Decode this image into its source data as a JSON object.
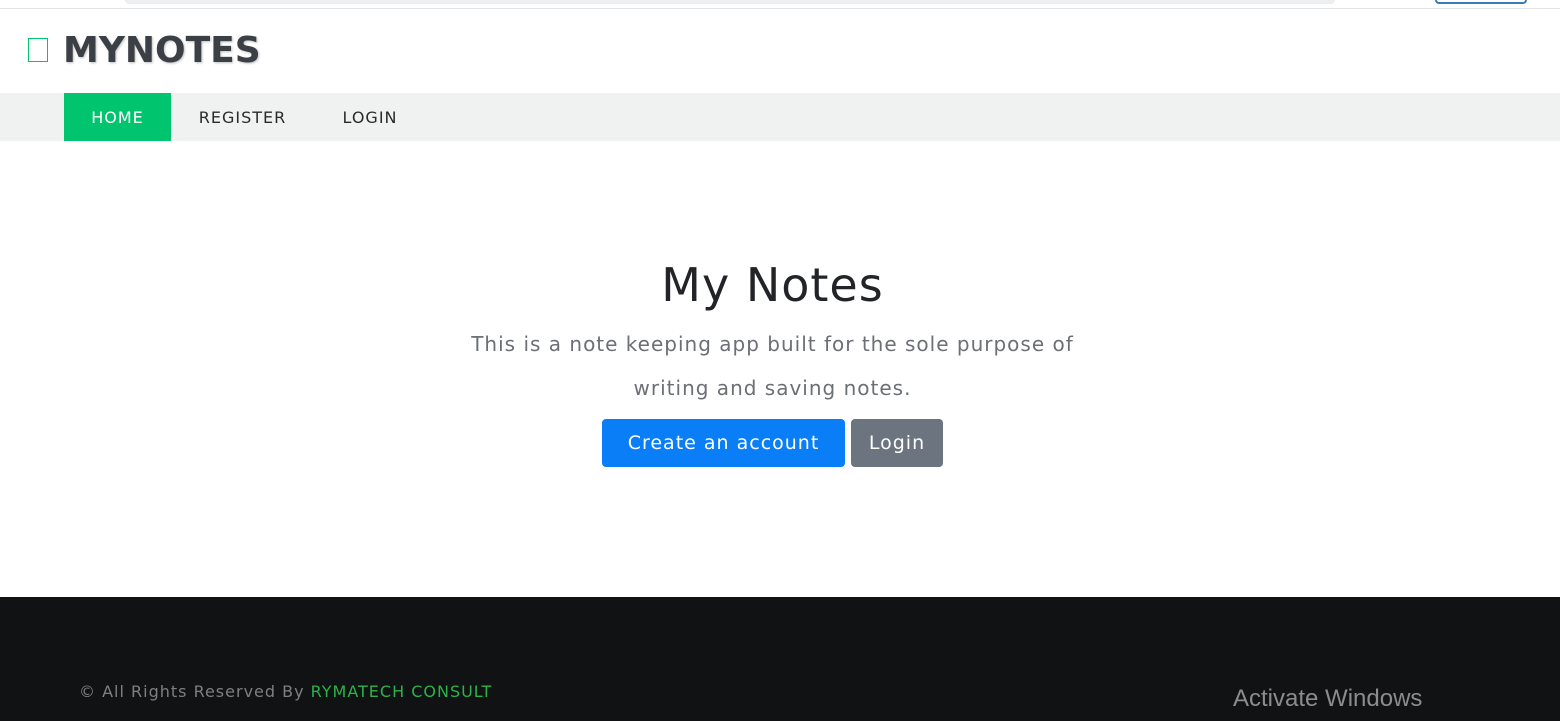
{
  "brand": {
    "title": "MYNOTES",
    "icon": "notebook-outline-icon",
    "accent_color": "#00c56e"
  },
  "nav": {
    "items": [
      {
        "label": "HOME",
        "active": true
      },
      {
        "label": "REGISTER",
        "active": false
      },
      {
        "label": "LOGIN",
        "active": false
      }
    ],
    "active_color": "#00c56e",
    "background": "#f0f2f1"
  },
  "hero": {
    "title": "My Notes",
    "description": "This is a note keeping app built for the sole purpose of writing and saving notes.",
    "primary_button": "Create an account",
    "secondary_button": "Login",
    "primary_color": "#0a7ef7",
    "secondary_color": "#6b747f"
  },
  "footer": {
    "copyright_prefix": "© All Rights Reserved By ",
    "company_link": "RYMATECH CONSULT",
    "link_color": "#2bb34a",
    "background": "#111214"
  },
  "system": {
    "watermark": "Activate Windows"
  }
}
